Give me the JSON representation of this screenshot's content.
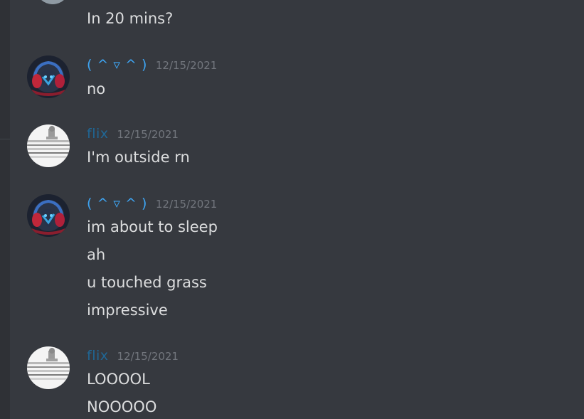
{
  "colors": {
    "background": "#36393f",
    "sidebar": "#2f3136",
    "text": "#dcddde",
    "timestamp": "#72767d",
    "username_kaomoji": "#3ea6f5",
    "username_flix": "#206694"
  },
  "messages": {
    "m0": {
      "lines": [
        "In 20 mins?"
      ]
    },
    "m1": {
      "username": "( ^ ▿ ^ )",
      "avatar_icon": "red-blue-headphones-avatar",
      "timestamp": "12/15/2021",
      "lines": [
        "no"
      ]
    },
    "m2": {
      "username": "flix",
      "avatar_icon": "grayscale-photo-avatar",
      "timestamp": "12/15/2021",
      "lines": [
        "I'm outside rn"
      ]
    },
    "m3": {
      "username": "( ^ ▿ ^ )",
      "avatar_icon": "red-blue-headphones-avatar",
      "timestamp": "12/15/2021",
      "lines": [
        "im about to sleep",
        "ah",
        "u touched grass",
        "impressive"
      ]
    },
    "m4": {
      "username": "flix",
      "avatar_icon": "grayscale-photo-avatar",
      "timestamp": "12/15/2021",
      "lines": [
        "LOOOOL",
        "NOOOOO"
      ]
    }
  }
}
